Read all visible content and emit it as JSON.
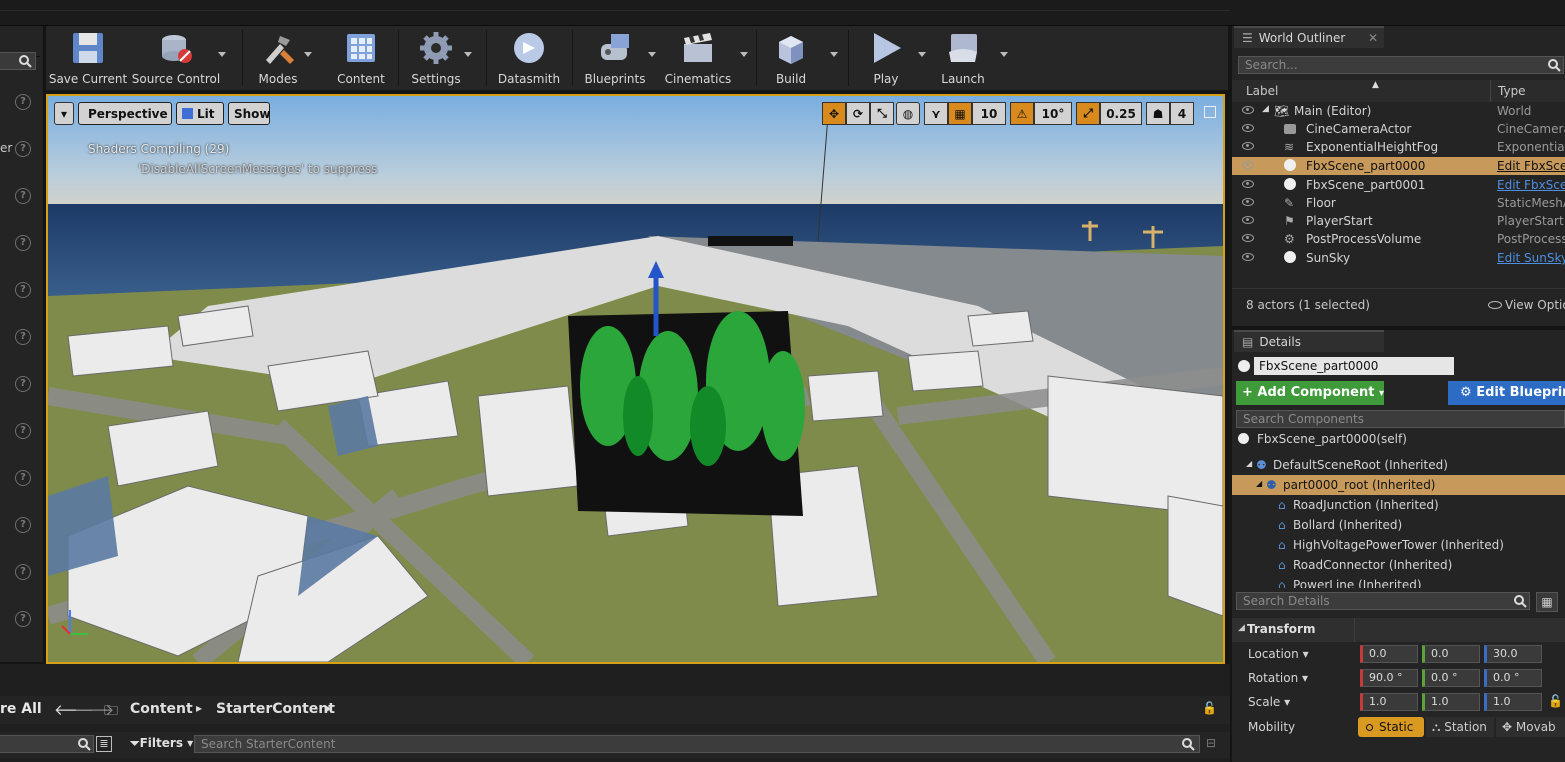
{
  "toolbar": {
    "items": [
      {
        "label": "Save Current",
        "icon": "save-icon"
      },
      {
        "label": "Source Control",
        "icon": "source-control-icon"
      },
      {
        "label": "Modes",
        "icon": "modes-icon"
      },
      {
        "label": "Content",
        "icon": "content-icon"
      },
      {
        "label": "Settings",
        "icon": "settings-icon"
      },
      {
        "label": "Datasmith",
        "icon": "datasmith-icon"
      },
      {
        "label": "Blueprints",
        "icon": "blueprints-icon"
      },
      {
        "label": "Cinematics",
        "icon": "cinematics-icon"
      },
      {
        "label": "Build",
        "icon": "build-icon"
      },
      {
        "label": "Play",
        "icon": "play-icon"
      },
      {
        "label": "Launch",
        "icon": "launch-icon"
      }
    ]
  },
  "left": {
    "truncated_text": "er"
  },
  "viewport": {
    "perspective": "Perspective",
    "lit": "Lit",
    "show": "Show",
    "grid_snap": "10",
    "rotation_snap": "10°",
    "scale_snap": "0.25",
    "camera_speed": "4",
    "message": "Shaders Compiling (29)",
    "message_hint": "'DisableAllScreenMessages' to suppress"
  },
  "outliner": {
    "title": "World Outliner",
    "search_placeholder": "Search...",
    "col_label": "Label",
    "col_type": "Type",
    "rows": [
      {
        "name": "Main (Editor)",
        "type": "World",
        "link": false,
        "selected": false
      },
      {
        "name": "CineCameraActor",
        "type": "CineCameraA",
        "link": false,
        "selected": false
      },
      {
        "name": "ExponentialHeightFog",
        "type": "ExponentialH",
        "link": false,
        "selected": false
      },
      {
        "name": "FbxScene_part0000",
        "type": "Edit FbxSce",
        "link": true,
        "selected": true
      },
      {
        "name": "FbxScene_part0001",
        "type": "Edit FbxSce",
        "link": true,
        "selected": false
      },
      {
        "name": "Floor",
        "type": "StaticMeshA",
        "link": false,
        "selected": false
      },
      {
        "name": "PlayerStart",
        "type": "PlayerStart",
        "link": false,
        "selected": false
      },
      {
        "name": "PostProcessVolume",
        "type": "PostProcess",
        "link": false,
        "selected": false
      },
      {
        "name": "SunSky",
        "type": "Edit SunSky",
        "link": true,
        "selected": false
      }
    ],
    "status": "8 actors (1 selected)",
    "view_options": "View Optio"
  },
  "details": {
    "title": "Details",
    "actor_name": "FbxScene_part0000",
    "add_component": "+ Add Component",
    "edit_blueprint": "Edit Blueprin",
    "search_components": "Search Components",
    "self_row": "FbxScene_part0000(self)",
    "components": [
      {
        "name": "DefaultSceneRoot (Inherited)",
        "indent": 1,
        "selected": false
      },
      {
        "name": "part0000_root (Inherited)",
        "indent": 2,
        "selected": true
      },
      {
        "name": "RoadJunction (Inherited)",
        "indent": 3,
        "selected": false
      },
      {
        "name": "Bollard (Inherited)",
        "indent": 3,
        "selected": false
      },
      {
        "name": "HighVoltagePowerTower (Inherited)",
        "indent": 3,
        "selected": false
      },
      {
        "name": "RoadConnector (Inherited)",
        "indent": 3,
        "selected": false
      },
      {
        "name": "PowerLine (Inherited)",
        "indent": 3,
        "selected": false
      }
    ],
    "search_details": "Search Details",
    "transform_header": "Transform",
    "location_label": "Location",
    "rotation_label": "Rotation",
    "scale_label": "Scale",
    "mobility_label": "Mobility",
    "location": [
      "0.0",
      "0.0",
      "30.0"
    ],
    "rotation": [
      "90.0 °",
      "0.0 °",
      "0.0 °"
    ],
    "scale": [
      "1.0",
      "1.0",
      "1.0"
    ],
    "mobility": [
      "Static",
      "Station",
      "Movab"
    ]
  },
  "content_browser": {
    "save_all": "re All",
    "path": [
      "Content",
      "StarterContent"
    ],
    "filters": "Filters",
    "search_placeholder": "Search StarterContent"
  }
}
